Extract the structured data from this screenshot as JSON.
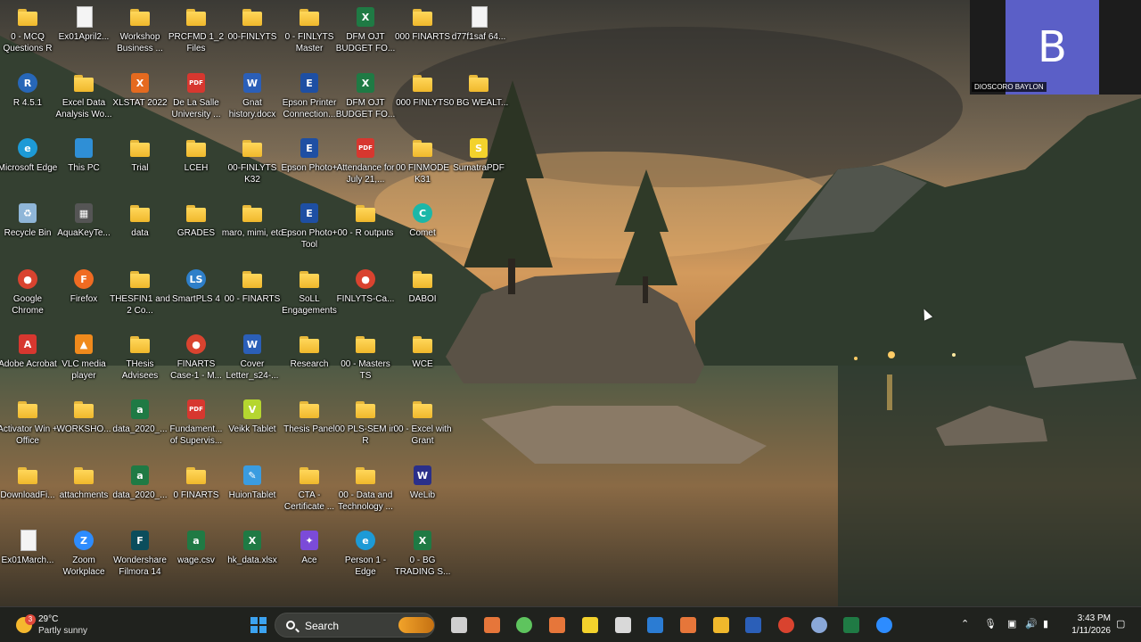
{
  "desktop": {
    "icons": [
      {
        "label": "0 - MCQ Questions R",
        "icon": "folder-icon"
      },
      {
        "label": "Ex01April2...",
        "icon": "file-icon"
      },
      {
        "label": "Workshop Business ...",
        "icon": "folder-icon"
      },
      {
        "label": "PRCFMD 1_2 Files",
        "icon": "folder-icon"
      },
      {
        "label": "00-FINLYTS",
        "icon": "folder-icon"
      },
      {
        "label": "0 - FINLYTS Master",
        "icon": "folder-icon"
      },
      {
        "label": "DFM OJT BUDGET FO...",
        "icon": "excel-icon"
      },
      {
        "label": "000 FINARTS",
        "icon": "folder-icon"
      },
      {
        "label": "d77f1saf 64...",
        "icon": "file-icon"
      },
      {
        "label": "R 4.5.1",
        "icon": "r-icon"
      },
      {
        "label": "Excel Data Analysis Wo...",
        "icon": "folder-icon"
      },
      {
        "label": "XLSTAT 2022",
        "icon": "xlstat-icon"
      },
      {
        "label": "De La Salle University ...",
        "icon": "pdf-icon"
      },
      {
        "label": "Gnat history.docx",
        "icon": "word-icon"
      },
      {
        "label": "Epson Printer Connection...",
        "icon": "epson-icon"
      },
      {
        "label": "DFM OJT BUDGET FO...",
        "icon": "excel-icon"
      },
      {
        "label": "000 FINLYTS",
        "icon": "folder-icon"
      },
      {
        "label": "0 BG WEALT...",
        "icon": "folder-icon"
      },
      {
        "label": "Microsoft Edge",
        "icon": "edge-icon"
      },
      {
        "label": "This PC",
        "icon": "pc-icon"
      },
      {
        "label": "Trial",
        "icon": "folder-icon"
      },
      {
        "label": "LCEH",
        "icon": "folder-icon"
      },
      {
        "label": "00-FINLYTS K32",
        "icon": "folder-icon"
      },
      {
        "label": "Epson Photo+",
        "icon": "epson-icon"
      },
      {
        "label": "Attendance for July 21,...",
        "icon": "pdf-icon"
      },
      {
        "label": "00 FINMODE K31",
        "icon": "folder-icon"
      },
      {
        "label": "SumatraPDF",
        "icon": "sumatra-icon"
      },
      {
        "label": "Recycle Bin",
        "icon": "recycle-bin-icon"
      },
      {
        "label": "AquaKeyTe...",
        "icon": "calculator-icon"
      },
      {
        "label": "data",
        "icon": "folder-icon"
      },
      {
        "label": "GRADES",
        "icon": "folder-icon"
      },
      {
        "label": "maro, mimi, etc",
        "icon": "folder-icon"
      },
      {
        "label": "Epson Photo+ Tool",
        "icon": "epson-icon"
      },
      {
        "label": "00 - R outputs",
        "icon": "folder-icon"
      },
      {
        "label": "Comet",
        "icon": "comet-icon"
      },
      {
        "label": "Google Chrome",
        "icon": "chrome-icon"
      },
      {
        "label": "Firefox",
        "icon": "firefox-icon"
      },
      {
        "label": "THESFIN1 and 2 Co...",
        "icon": "folder-icon"
      },
      {
        "label": "SmartPLS 4",
        "icon": "smartpls-icon"
      },
      {
        "label": "00 - FINARTS",
        "icon": "folder-icon"
      },
      {
        "label": "SoLL Engagements",
        "icon": "folder-icon"
      },
      {
        "label": "FINLYTS-Ca...",
        "icon": "chrome-icon"
      },
      {
        "label": "DABOI",
        "icon": "folder-icon"
      },
      {
        "label": "Adobe Acrobat",
        "icon": "acrobat-icon"
      },
      {
        "label": "VLC media player",
        "icon": "vlc-icon"
      },
      {
        "label": "THesis Advisees",
        "icon": "folder-icon"
      },
      {
        "label": "FINARTS Case-1 - M...",
        "icon": "chrome-icon"
      },
      {
        "label": "Cover Letter_s24-...",
        "icon": "word-icon"
      },
      {
        "label": "Research",
        "icon": "folder-icon"
      },
      {
        "label": "00 - Masters TS",
        "icon": "folder-icon"
      },
      {
        "label": "WCE",
        "icon": "folder-icon"
      },
      {
        "label": "Activator Win + Office",
        "icon": "folder-icon"
      },
      {
        "label": "WORKSHO...",
        "icon": "folder-icon"
      },
      {
        "label": "data_2020_...",
        "icon": "csv-icon"
      },
      {
        "label": "Fundament... of Supervis...",
        "icon": "pdf-icon"
      },
      {
        "label": "Veikk Tablet",
        "icon": "veikk-icon"
      },
      {
        "label": "Thesis Panel",
        "icon": "folder-icon"
      },
      {
        "label": "00 PLS-SEM in R",
        "icon": "folder-icon"
      },
      {
        "label": "00 - Excel with Grant",
        "icon": "folder-icon"
      },
      {
        "label": "DownloadFi...",
        "icon": "folder-icon"
      },
      {
        "label": "attachments",
        "icon": "folder-icon"
      },
      {
        "label": "data_2020_...",
        "icon": "csv-icon"
      },
      {
        "label": "0 FINARTS",
        "icon": "folder-icon"
      },
      {
        "label": "HuionTablet",
        "icon": "huion-icon"
      },
      {
        "label": "CTA - Certificate ...",
        "icon": "folder-icon"
      },
      {
        "label": "00 - Data and Technology ...",
        "icon": "folder-icon"
      },
      {
        "label": "WeLib",
        "icon": "welib-icon"
      },
      {
        "label": "Ex01March...",
        "icon": "file-icon"
      },
      {
        "label": "Zoom Workplace",
        "icon": "zoom-icon"
      },
      {
        "label": "Wondershare Filmora 14",
        "icon": "filmora-icon"
      },
      {
        "label": "wage.csv",
        "icon": "csv-icon"
      },
      {
        "label": "hk_data.xlsx",
        "icon": "excel-icon"
      },
      {
        "label": "Ace",
        "icon": "ace-icon"
      },
      {
        "label": "Person 1 - Edge",
        "icon": "edge-icon"
      },
      {
        "label": "0 - BG TRADING S...",
        "icon": "excel-icon"
      }
    ]
  },
  "meeting": {
    "avatar_letter": "B",
    "participant_name": "DIOSCORO BAYLON"
  },
  "taskbar": {
    "weather": {
      "temp": "29°C",
      "condition": "Partly sunny",
      "badge": "3"
    },
    "search_placeholder": "Search",
    "clock": {
      "time": "3:43 PM",
      "date": "1/11/2026"
    },
    "pinned": [
      "task-view-icon",
      "app-icon",
      "copilot-icon",
      "app-icon",
      "sticky-notes-icon",
      "snipping-tool-icon",
      "outlook-icon",
      "app-icon",
      "file-explorer-icon",
      "word-icon",
      "chrome-icon",
      "r-icon",
      "excel-icon",
      "zoom-icon"
    ]
  },
  "colors": {
    "folder": "#f0b82c",
    "excel": "#1f7a44",
    "word": "#2b5fb8",
    "pdf": "#d7372f",
    "avatar": "#5b5fc7",
    "taskbar": "#20221e"
  }
}
